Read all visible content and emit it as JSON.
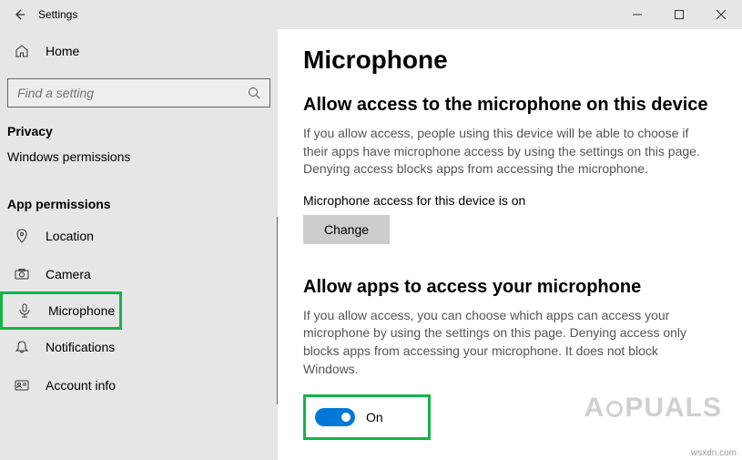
{
  "app": {
    "title": "Settings"
  },
  "sidebar": {
    "home_label": "Home",
    "search_placeholder": "Find a setting",
    "privacy_header": "Privacy",
    "windows_perms_label": "Windows permissions",
    "app_perms_header": "App permissions",
    "items": [
      {
        "label": "Location"
      },
      {
        "label": "Camera"
      },
      {
        "label": "Microphone"
      },
      {
        "label": "Notifications"
      },
      {
        "label": "Account info"
      }
    ]
  },
  "content": {
    "page_title": "Microphone",
    "section1_title": "Allow access to the microphone on this device",
    "section1_desc": "If you allow access, people using this device will be able to choose if their apps have microphone access by using the settings on this page. Denying access blocks apps from accessing the microphone.",
    "status_line": "Microphone access for this device is on",
    "change_btn": "Change",
    "section2_title": "Allow apps to access your microphone",
    "section2_desc": "If you allow access, you can choose which apps can access your microphone by using the settings on this page. Denying access only blocks apps from accessing your microphone. It does not block Windows.",
    "toggle_label": "On"
  },
  "watermark": {
    "text_left": "A",
    "text_right": "PUALS"
  },
  "credit": "wsxdn.com"
}
